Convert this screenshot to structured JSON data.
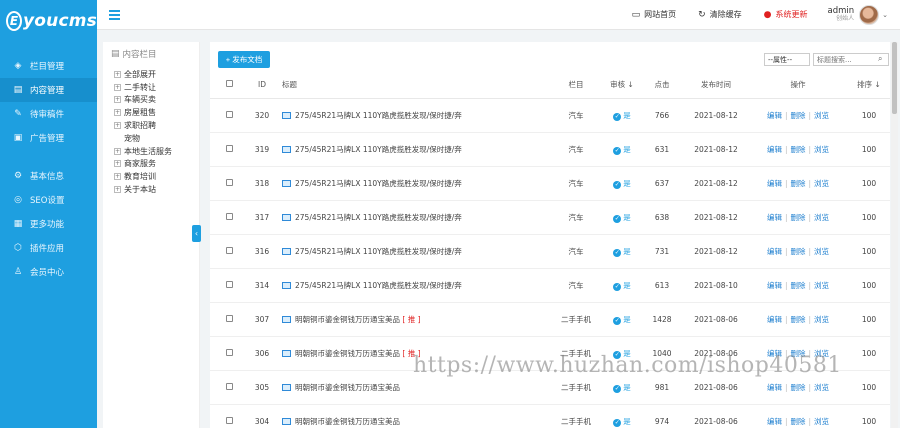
{
  "brand": {
    "badge": "E",
    "name": "youcms"
  },
  "nav": [
    {
      "label": "栏目管理",
      "icon": "layers-icon"
    },
    {
      "label": "内容管理",
      "icon": "document-icon",
      "active": true
    },
    {
      "label": "待审稿件",
      "icon": "review-icon"
    },
    {
      "label": "广告管理",
      "icon": "ad-icon"
    },
    {
      "label": "基本信息",
      "icon": "gear-icon"
    },
    {
      "label": "SEO设置",
      "icon": "seo-icon"
    },
    {
      "label": "更多功能",
      "icon": "grid-icon"
    },
    {
      "label": "插件应用",
      "icon": "plugin-icon"
    },
    {
      "label": "会员中心",
      "icon": "user-icon"
    }
  ],
  "topbar": {
    "home_link": "网站首页",
    "clear_cache": "清除缓存",
    "system_update": "系统更新",
    "user_name": "admin",
    "user_role": "创始人"
  },
  "tree": {
    "title": "内容栏目",
    "items": [
      {
        "label": "全部展开",
        "plus": true
      },
      {
        "label": "二手转让",
        "plus": true
      },
      {
        "label": "车辆买卖",
        "plus": true
      },
      {
        "label": "房屋租售",
        "plus": true
      },
      {
        "label": "求职招聘",
        "plus": true
      },
      {
        "label": "宠物",
        "plus": false
      },
      {
        "label": "本地生活服务",
        "plus": true
      },
      {
        "label": "商家服务",
        "plus": true
      },
      {
        "label": "教育培训",
        "plus": true
      },
      {
        "label": "关于本站",
        "plus": true
      }
    ]
  },
  "toolbar": {
    "publish_label": "+ 发布文档",
    "filter_value": "--属性--",
    "search_placeholder": "标题搜索..."
  },
  "table": {
    "headers": {
      "id": "ID",
      "title": "标题",
      "column": "栏目",
      "audit": "审核",
      "clicks": "点击",
      "time": "发布时间",
      "ops": "操作",
      "sort": "排序"
    },
    "sort_arrow": "↓",
    "ops": {
      "edit": "编辑",
      "delete": "删除",
      "view": "浏览"
    },
    "rows": [
      {
        "id": "320",
        "title": "275/45R21马牌LX 110Y路虎揽胜发现/保时捷/奔",
        "img": true,
        "tag": "",
        "column": "汽车",
        "audit": "是",
        "clicks": "766",
        "time": "2021-08-12",
        "sort": "100"
      },
      {
        "id": "319",
        "title": "275/45R21马牌LX 110Y路虎揽胜发现/保时捷/奔",
        "img": true,
        "tag": "",
        "column": "汽车",
        "audit": "是",
        "clicks": "631",
        "time": "2021-08-12",
        "sort": "100"
      },
      {
        "id": "318",
        "title": "275/45R21马牌LX 110Y路虎揽胜发现/保时捷/奔",
        "img": true,
        "tag": "",
        "column": "汽车",
        "audit": "是",
        "clicks": "637",
        "time": "2021-08-12",
        "sort": "100"
      },
      {
        "id": "317",
        "title": "275/45R21马牌LX 110Y路虎揽胜发现/保时捷/奔",
        "img": true,
        "tag": "",
        "column": "汽车",
        "audit": "是",
        "clicks": "638",
        "time": "2021-08-12",
        "sort": "100"
      },
      {
        "id": "316",
        "title": "275/45R21马牌LX 110Y路虎揽胜发现/保时捷/奔",
        "img": true,
        "tag": "",
        "column": "汽车",
        "audit": "是",
        "clicks": "731",
        "time": "2021-08-12",
        "sort": "100"
      },
      {
        "id": "314",
        "title": "275/45R21马牌LX 110Y路虎揽胜发现/保时捷/奔",
        "img": true,
        "tag": "",
        "column": "汽车",
        "audit": "是",
        "clicks": "613",
        "time": "2021-08-10",
        "sort": "100"
      },
      {
        "id": "307",
        "title": "明朝铜币鎏金铜钱万历通宝美品",
        "img": true,
        "tag": "[ 推 ]",
        "column": "二手手机",
        "audit": "是",
        "clicks": "1428",
        "time": "2021-08-06",
        "sort": "100"
      },
      {
        "id": "306",
        "title": "明朝铜币鎏金铜钱万历通宝美品",
        "img": true,
        "tag": "[ 推 ]",
        "column": "二手手机",
        "audit": "是",
        "clicks": "1040",
        "time": "2021-08-06",
        "sort": "100"
      },
      {
        "id": "305",
        "title": "明朝铜币鎏金铜钱万历通宝美品",
        "img": true,
        "tag": "",
        "column": "二手手机",
        "audit": "是",
        "clicks": "981",
        "time": "2021-08-06",
        "sort": "100"
      },
      {
        "id": "304",
        "title": "明朝铜币鎏金铜钱万历通宝美品",
        "img": true,
        "tag": "",
        "column": "二手手机",
        "audit": "是",
        "clicks": "974",
        "time": "2021-08-06",
        "sort": "100"
      }
    ]
  },
  "watermark": "https://www.huzhan.com/ishop40581"
}
